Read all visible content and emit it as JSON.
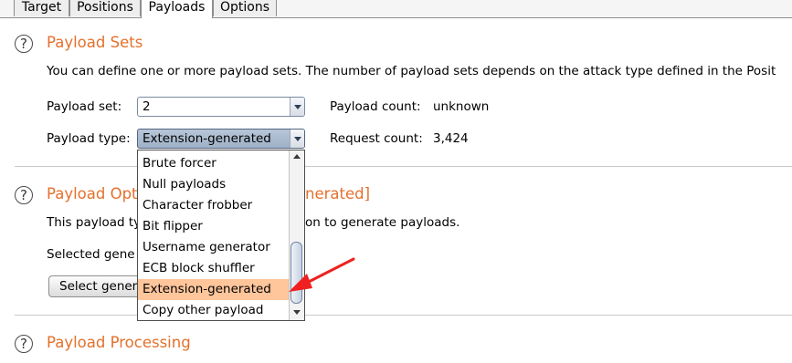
{
  "tabs": [
    {
      "label": "Target"
    },
    {
      "label": "Positions"
    },
    {
      "label": "Payloads",
      "active": true
    },
    {
      "label": "Options"
    }
  ],
  "payload_sets": {
    "title": "Payload Sets",
    "description": "You can define one or more payload sets. The number of payload sets depends on the attack type defined in the Posit",
    "set_label": "Payload set:",
    "set_value": "2",
    "type_label": "Payload type:",
    "type_value": "Extension-generated",
    "count_label": "Payload count:",
    "count_value": "unknown",
    "request_label": "Request count:",
    "request_value": "3,424"
  },
  "payload_options": {
    "title_left": "Payload Opt",
    "title_right": "nerated]",
    "description_left": "This payload ty",
    "description_right": "on to generate payloads.",
    "selected_label": "Selected gene",
    "select_button_label": "Select gener"
  },
  "payload_processing": {
    "title": "Payload Processing"
  },
  "dropdown": {
    "options": [
      "Brute forcer",
      "Null payloads",
      "Character frobber",
      "Bit flipper",
      "Username generator",
      "ECB block shuffler",
      "Extension-generated",
      "Copy other payload"
    ],
    "selected_index": 6
  },
  "annotation": {
    "color": "#f02020"
  },
  "colors": {
    "section_title": "#e5702c",
    "selected_item": "#ffc59b"
  },
  "icons": {
    "help": "?"
  }
}
